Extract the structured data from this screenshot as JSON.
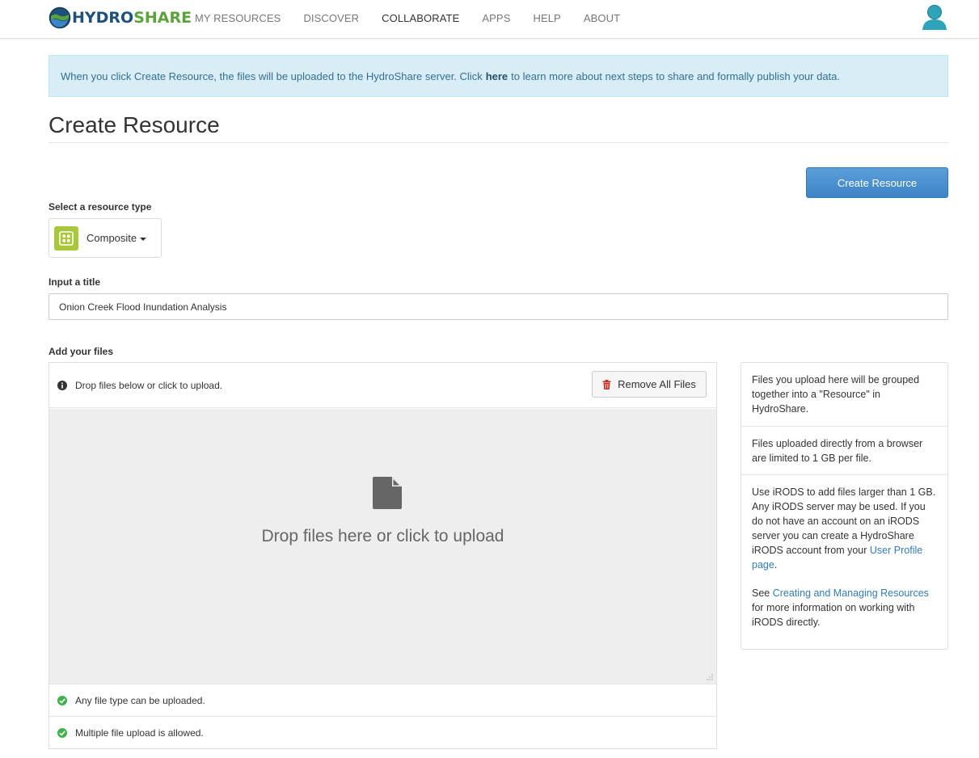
{
  "navbar": {
    "brand_part1": "HYDRO",
    "brand_part2": "SHARE",
    "items": [
      {
        "label": "MY RESOURCES"
      },
      {
        "label": "DISCOVER"
      },
      {
        "label": "COLLABORATE"
      },
      {
        "label": "APPS"
      },
      {
        "label": "HELP"
      },
      {
        "label": "ABOUT"
      }
    ],
    "active_item": "COLLABORATE"
  },
  "alert": {
    "text_before": "When you click Create Resource, the files will be uploaded to the HydroShare server. Click",
    "link": "here",
    "text_after": "to learn more about next steps to share and formally publish your data."
  },
  "page": {
    "title": "Create Resource",
    "create_button": "Create Resource"
  },
  "resource_type": {
    "label": "Select a resource type",
    "selected": "Composite"
  },
  "title_field": {
    "label": "Input a title",
    "value": "Onion Creek Flood Inundation Analysis"
  },
  "files": {
    "label": "Add your files",
    "instructions": "Drop files below or click to upload.",
    "remove_all": "Remove All Files",
    "dropzone_text": "Drop files here or click to upload",
    "notes": [
      "Any file type can be uploaded.",
      "Multiple file upload is allowed."
    ]
  },
  "side_panel": {
    "p1": "Files you upload here will be grouped together into a \"Resource\" in HydroShare.",
    "p2": "Files uploaded directly from a browser are limited to 1 GB per file.",
    "p3_text": "Use iRODS to add files larger than 1 GB. Any iRODS server may be used. If you do not have an account on an iRODS server you can create a HydroShare iRODS account from your",
    "p3_link": "User Profile page",
    "p3_end": ".",
    "p4_start": "See",
    "p4_link": "Creating and Managing Resources",
    "p4_end": "for more information on working with iRODS directly."
  },
  "colors": {
    "primary": "#3d84c6",
    "alert_bg": "#d9edf7",
    "success": "#3eb34a",
    "danger": "#c9302c",
    "type_icon": "#a9c73a"
  },
  "icons": [
    "globe-logo-icon",
    "user-avatar-icon",
    "composite-type-icon",
    "info-circle-icon",
    "trash-icon",
    "file-icon",
    "check-circle-icon",
    "resize-grip-icon"
  ]
}
